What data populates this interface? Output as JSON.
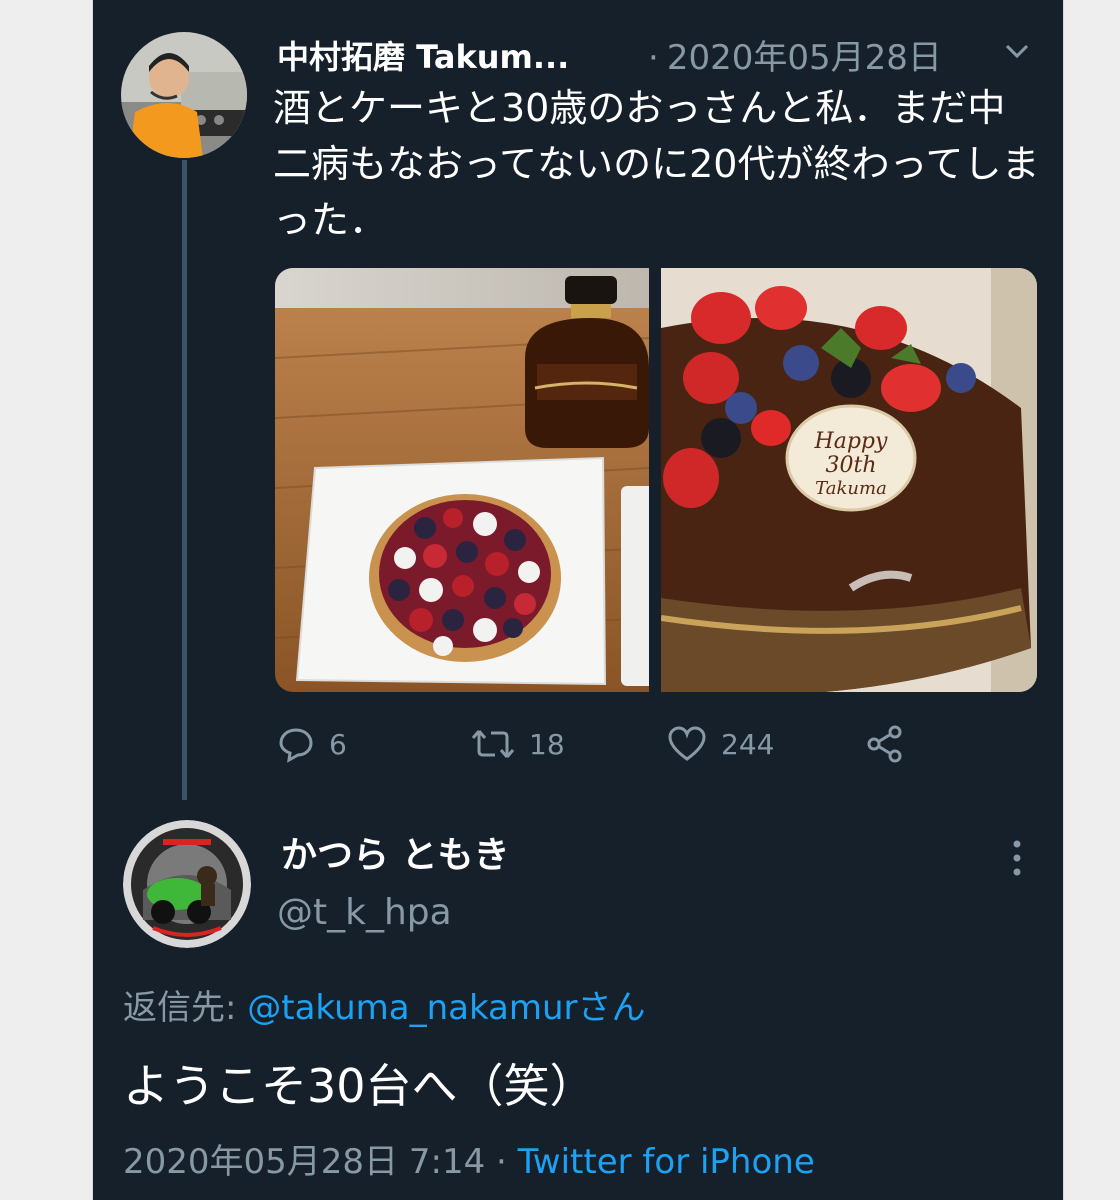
{
  "tweet": {
    "author_name": "中村拓磨 Takum...",
    "date": "2020年05月28日",
    "separator": "·",
    "text": "酒とケーキと30歳のおっさんと私．まだ中二病もなおってないのに20代が終わってしまった．",
    "images": [
      {
        "alt": "tart-and-liquor-photo"
      },
      {
        "alt": "chocolate-cake-photo",
        "plaque_text": "Happy 30th Takuma"
      }
    ],
    "actions": {
      "reply_count": "6",
      "retweet_count": "18",
      "like_count": "244"
    }
  },
  "reply": {
    "author_name": "かつら ともき",
    "handle": "@t_k_hpa",
    "reply_to_label": "返信先: ",
    "reply_to_mention": "@takuma_nakamur",
    "reply_to_suffix": "さん",
    "text": "ようこそ30台へ（笑）",
    "timestamp": "2020年05月28日 7:14",
    "separator": "·",
    "source": "Twitter for iPhone"
  },
  "colors": {
    "background": "#15202b",
    "text": "#ffffff",
    "muted": "#8899a6",
    "link": "#1da1f2"
  }
}
